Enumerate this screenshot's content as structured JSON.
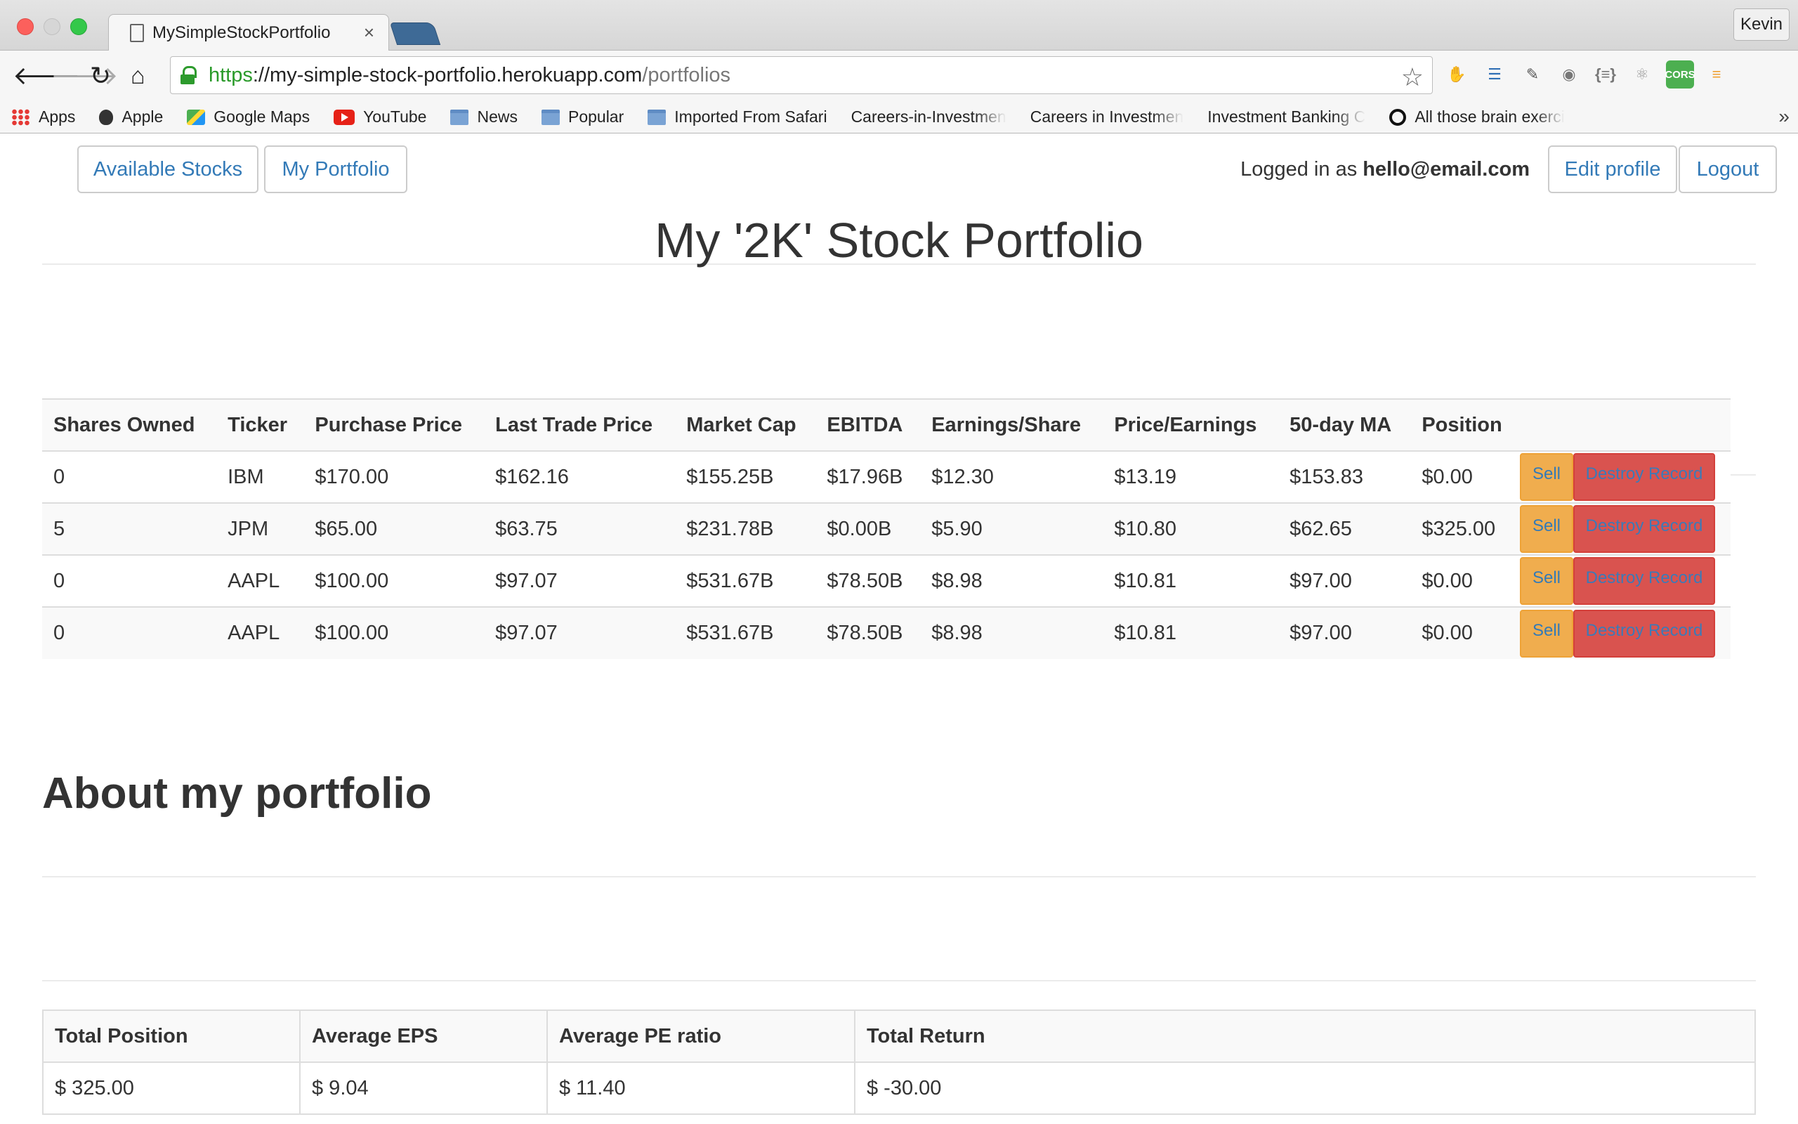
{
  "browser": {
    "tab_title": "MySimpleStockPortfolio",
    "tab_close": "×",
    "profile_name": "Kevin",
    "url": {
      "scheme": "https",
      "separator": "://",
      "host": "my-simple-stock-portfolio.herokuapp.com",
      "path": "/portfolios"
    },
    "bookmarks": [
      {
        "label": "Apps",
        "icon": "apps-grid-icon"
      },
      {
        "label": "Apple",
        "icon": "apple-icon"
      },
      {
        "label": "Google Maps",
        "icon": "maps-icon"
      },
      {
        "label": "YouTube",
        "icon": "youtube-icon"
      },
      {
        "label": "News",
        "icon": "folder-icon"
      },
      {
        "label": "Popular",
        "icon": "folder-icon"
      },
      {
        "label": "Imported From Safari",
        "icon": "folder-icon"
      },
      {
        "label": "Careers-in-Investmen",
        "icon": "page-icon"
      },
      {
        "label": "Careers in Investmen",
        "icon": "page-icon"
      },
      {
        "label": "Investment Banking C",
        "icon": "page-icon"
      },
      {
        "label": "All those brain exerci",
        "icon": "quora-icon"
      }
    ],
    "bookmarks_overflow": "»",
    "extensions": [
      {
        "name": "adblock-icon",
        "color": "#e53935",
        "glyph": "✋"
      },
      {
        "name": "rss-icon",
        "color": "#2f6fb5",
        "glyph": "☰"
      },
      {
        "name": "eyedropper-icon",
        "color": "#555555",
        "glyph": "✎"
      },
      {
        "name": "record-icon",
        "color": "#777777",
        "glyph": "◉"
      },
      {
        "name": "json-icon",
        "color": "#777777",
        "glyph": "{≡}"
      },
      {
        "name": "react-icon",
        "color": "#999999",
        "glyph": "⚛"
      },
      {
        "name": "cors-icon",
        "color": "#4caf50",
        "glyph": "CORS"
      },
      {
        "name": "menu-icon",
        "color": "#f0a030",
        "glyph": "≡"
      }
    ]
  },
  "nav": {
    "available_stocks": "Available Stocks",
    "my_portfolio": "My Portfolio",
    "logged_in_prefix": "Logged in as",
    "user_email": "hello@email.com",
    "edit_profile": "Edit profile",
    "logout": "Logout"
  },
  "portfolio": {
    "title": "My '2K' Stock Portfolio",
    "columns": [
      "Shares Owned",
      "Ticker",
      "Purchase Price",
      "Last Trade Price",
      "Market Cap",
      "EBITDA",
      "Earnings/Share",
      "Price/Earnings",
      "50-day MA",
      "Position"
    ],
    "rows": [
      [
        "0",
        "IBM",
        "$170.00",
        "$162.16",
        "$155.25B",
        "$17.96B",
        "$12.30",
        "$13.19",
        "$153.83",
        "$0.00"
      ],
      [
        "5",
        "JPM",
        "$65.00",
        "$63.75",
        "$231.78B",
        "$0.00B",
        "$5.90",
        "$10.80",
        "$62.65",
        "$325.00"
      ],
      [
        "0",
        "AAPL",
        "$100.00",
        "$97.07",
        "$531.67B",
        "$78.50B",
        "$8.98",
        "$10.81",
        "$97.00",
        "$0.00"
      ],
      [
        "0",
        "AAPL",
        "$100.00",
        "$97.07",
        "$531.67B",
        "$78.50B",
        "$8.98",
        "$10.81",
        "$97.00",
        "$0.00"
      ]
    ],
    "sell_label": "Sell",
    "destroy_label": "Destroy Record"
  },
  "about": {
    "title": "About my portfolio",
    "columns": [
      "Total Position",
      "Average EPS",
      "Average PE ratio",
      "Total Return"
    ],
    "values": [
      "$ 325.00",
      "$ 9.04",
      "$ 11.40",
      "$ -30.00"
    ]
  },
  "colors": {
    "link": "#337ab7",
    "warning": "#f0ad4e",
    "danger": "#d9534f",
    "secure": "#2a9a2a"
  }
}
